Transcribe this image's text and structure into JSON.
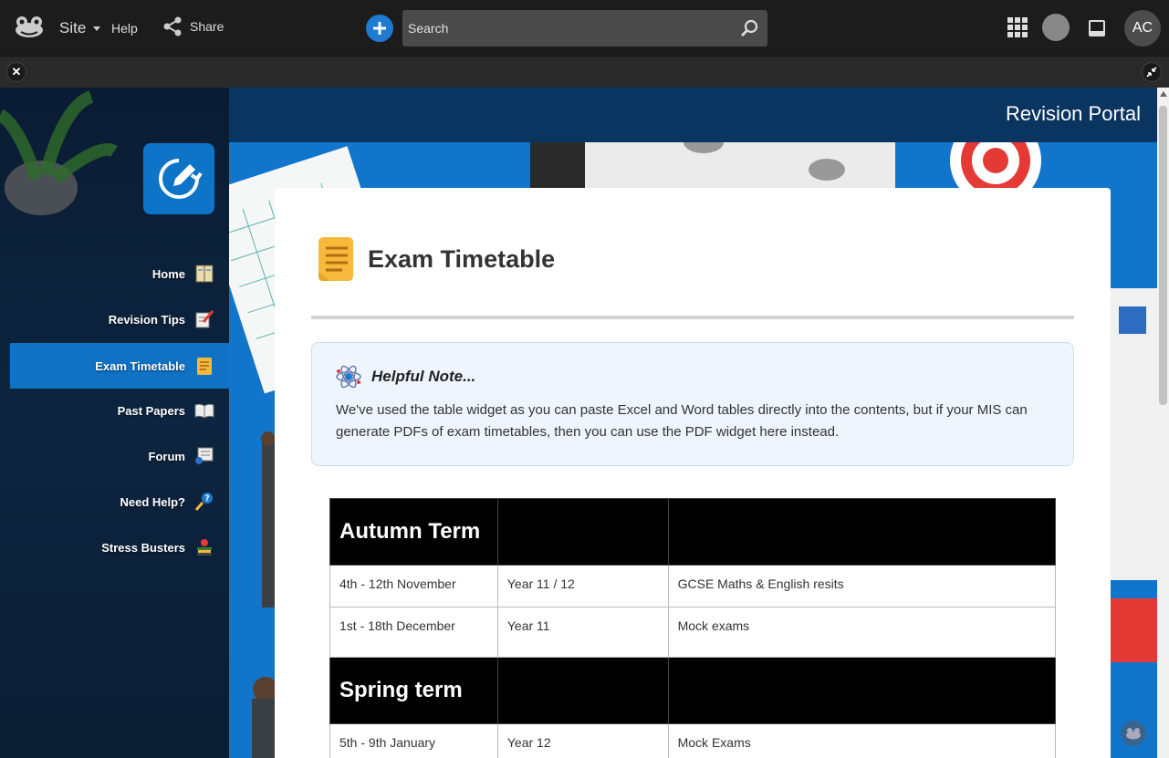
{
  "topbar": {
    "site_label": "Site",
    "help_label": "Help",
    "share_label": "Share",
    "search_placeholder": "Search",
    "avatar_initials": "AC"
  },
  "portal": {
    "title": "Revision Portal"
  },
  "sidebar": {
    "items": [
      {
        "label": "Home",
        "icon": "notebook-icon",
        "active": false
      },
      {
        "label": "Revision Tips",
        "icon": "checklist-pencil-icon",
        "active": false
      },
      {
        "label": "Exam Timetable",
        "icon": "notepad-icon",
        "active": true
      },
      {
        "label": "Past Papers",
        "icon": "open-book-icon",
        "active": false
      },
      {
        "label": "Forum",
        "icon": "chat-icon",
        "active": false
      },
      {
        "label": "Need Help?",
        "icon": "help-magnifier-icon",
        "active": false
      },
      {
        "label": "Stress Busters",
        "icon": "books-apple-icon",
        "active": false
      }
    ]
  },
  "page": {
    "title": "Exam Timetable",
    "note_title": "Helpful Note...",
    "note_body": "We've used the table widget as you can paste Excel and Word tables directly into the contents, but if your MIS can generate PDFs of exam timetables, then you can use the PDF widget here instead."
  },
  "timetable": {
    "autumn": {
      "heading": "Autumn Term",
      "rows": [
        [
          "4th - 12th November",
          "Year 11 / 12",
          "GCSE Maths & English resits"
        ],
        [
          "1st - 18th December",
          "Year 11",
          "Mock exams"
        ]
      ]
    },
    "spring": {
      "heading": "Spring term",
      "rows": [
        [
          "5th - 9th January",
          "Year 12",
          "Mock Exams"
        ]
      ]
    }
  },
  "colors": {
    "accent": "#0f72c5",
    "topbar": "#1c1c1c",
    "table_header": "#000000"
  }
}
